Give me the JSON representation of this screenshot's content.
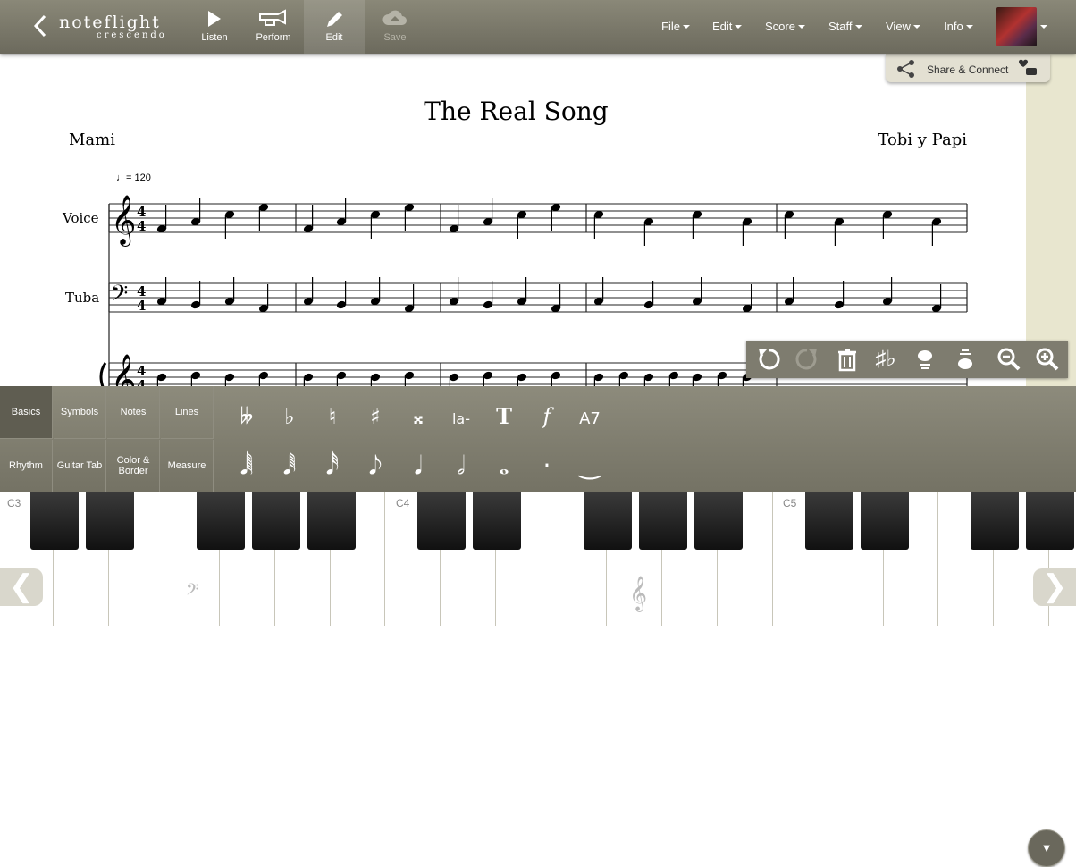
{
  "app": {
    "logo_top": "noteflight",
    "logo_bottom": "crescendo"
  },
  "toolbar": {
    "tools": [
      {
        "label": "Listen",
        "icon": "play-icon"
      },
      {
        "label": "Perform",
        "icon": "trumpet-icon"
      },
      {
        "label": "Edit",
        "icon": "pencil-icon",
        "active": true
      },
      {
        "label": "Save",
        "icon": "cloud-upload-icon",
        "disabled": true
      }
    ],
    "menus": [
      "File",
      "Edit",
      "Score",
      "Staff",
      "View",
      "Info"
    ]
  },
  "share": {
    "label": "Share & Connect"
  },
  "score": {
    "title": "The Real Song",
    "lyricist": "Mami",
    "composer": "Tobi y Papi",
    "tempo": "= 120",
    "staves": [
      {
        "name": "Voice"
      },
      {
        "name": "Tuba"
      },
      {
        "name": ""
      }
    ],
    "time_signature": "4/4"
  },
  "score_tools": [
    "undo-icon",
    "redo-icon",
    "delete-icon",
    "enharmonic-icon",
    "voice-up-icon",
    "voice-down-icon",
    "zoom-out-icon",
    "zoom-in-icon"
  ],
  "palette": {
    "categories": [
      "Basics",
      "Symbols",
      "Notes",
      "Lines",
      "Rhythm",
      "Guitar Tab",
      "Color & Border",
      "Measure"
    ],
    "selected": "Basics",
    "row1": [
      {
        "glyph": "𝄫",
        "name": "double-flat"
      },
      {
        "glyph": "♭",
        "name": "flat"
      },
      {
        "glyph": "♮",
        "name": "natural"
      },
      {
        "glyph": "♯",
        "name": "sharp"
      },
      {
        "glyph": "𝄪",
        "name": "double-sharp"
      },
      {
        "glyph": "la-",
        "name": "lyric"
      },
      {
        "glyph": "T",
        "name": "text"
      },
      {
        "glyph": "f",
        "name": "dynamic"
      },
      {
        "glyph": "A7",
        "name": "chord-symbol"
      }
    ],
    "row2": [
      {
        "glyph": "𝅘𝅥𝅲",
        "name": "64th-note"
      },
      {
        "glyph": "𝅘𝅥𝅱",
        "name": "32nd-note"
      },
      {
        "glyph": "𝅘𝅥𝅰",
        "name": "16th-note"
      },
      {
        "glyph": "𝅘𝅥𝅮",
        "name": "eighth-note"
      },
      {
        "glyph": "𝅘𝅥",
        "name": "quarter-note"
      },
      {
        "glyph": "𝅗𝅥",
        "name": "half-note"
      },
      {
        "glyph": "𝅝",
        "name": "whole-note"
      },
      {
        "glyph": "·",
        "name": "dot"
      },
      {
        "glyph": "‿",
        "name": "tie"
      }
    ]
  },
  "piano": {
    "labels": [
      "C3",
      "C4",
      "C5"
    ]
  },
  "colors": {
    "toolbar": "#7c7a6c",
    "palette": "#7f7d70",
    "accent": "#e8e6cf"
  }
}
